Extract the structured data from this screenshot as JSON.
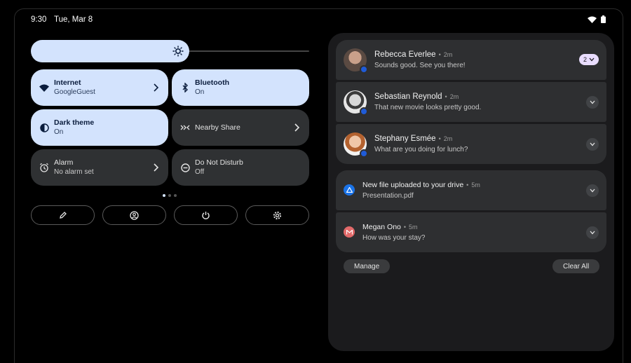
{
  "status_bar": {
    "time": "9:30",
    "date": "Tue, Mar 8"
  },
  "brightness": {
    "level": 0.57
  },
  "tiles": [
    {
      "title": "Internet",
      "subtitle": "GoogleGuest",
      "state": "on",
      "icon": "wifi-icon",
      "has_chevron": true
    },
    {
      "title": "Bluetooth",
      "subtitle": "On",
      "state": "on",
      "icon": "bluetooth-icon",
      "has_chevron": false
    },
    {
      "title": "Dark theme",
      "subtitle": "On",
      "state": "on",
      "icon": "dark-theme-icon",
      "has_chevron": false
    },
    {
      "title": "Nearby Share",
      "subtitle": "",
      "state": "off",
      "icon": "nearby-share-icon",
      "has_chevron": true
    },
    {
      "title": "Alarm",
      "subtitle": "No alarm set",
      "state": "off",
      "icon": "alarm-icon",
      "has_chevron": true
    },
    {
      "title": "Do Not Disturb",
      "subtitle": "Off",
      "state": "off",
      "icon": "do-not-disturb-icon",
      "has_chevron": false
    }
  ],
  "page_indicator": {
    "pages": 3,
    "active": 0
  },
  "quick_buttons": [
    "pencil-icon",
    "user-icon",
    "power-icon",
    "gear-icon"
  ],
  "notifications": {
    "conversations": [
      {
        "name": "Rebecca Everlee",
        "time": "2m",
        "message": "Sounds good. See you there!",
        "count": "2"
      },
      {
        "name": "Sebastian Reynold",
        "time": "2m",
        "message": "That new movie looks pretty good."
      },
      {
        "name": "Stephany Esmée",
        "time": "2m",
        "message": "What are you doing for lunch?"
      }
    ],
    "alerts": [
      {
        "title": "New file uploaded to your drive",
        "time": "5m",
        "body": "Presentation.pdf",
        "icon": "drive-icon"
      },
      {
        "title": "Megan Ono",
        "time": "5m",
        "body": "How was your stay?",
        "icon": "gmail-icon"
      }
    ],
    "manage_label": "Manage",
    "clear_all_label": "Clear All"
  },
  "colors": {
    "accent": "#d3e3fd",
    "tile_off": "#2f3133",
    "panel": "#1b1b1d",
    "card": "#2e2f31",
    "badge": "#1f5bd8",
    "count_pill": "#e9ddff"
  }
}
